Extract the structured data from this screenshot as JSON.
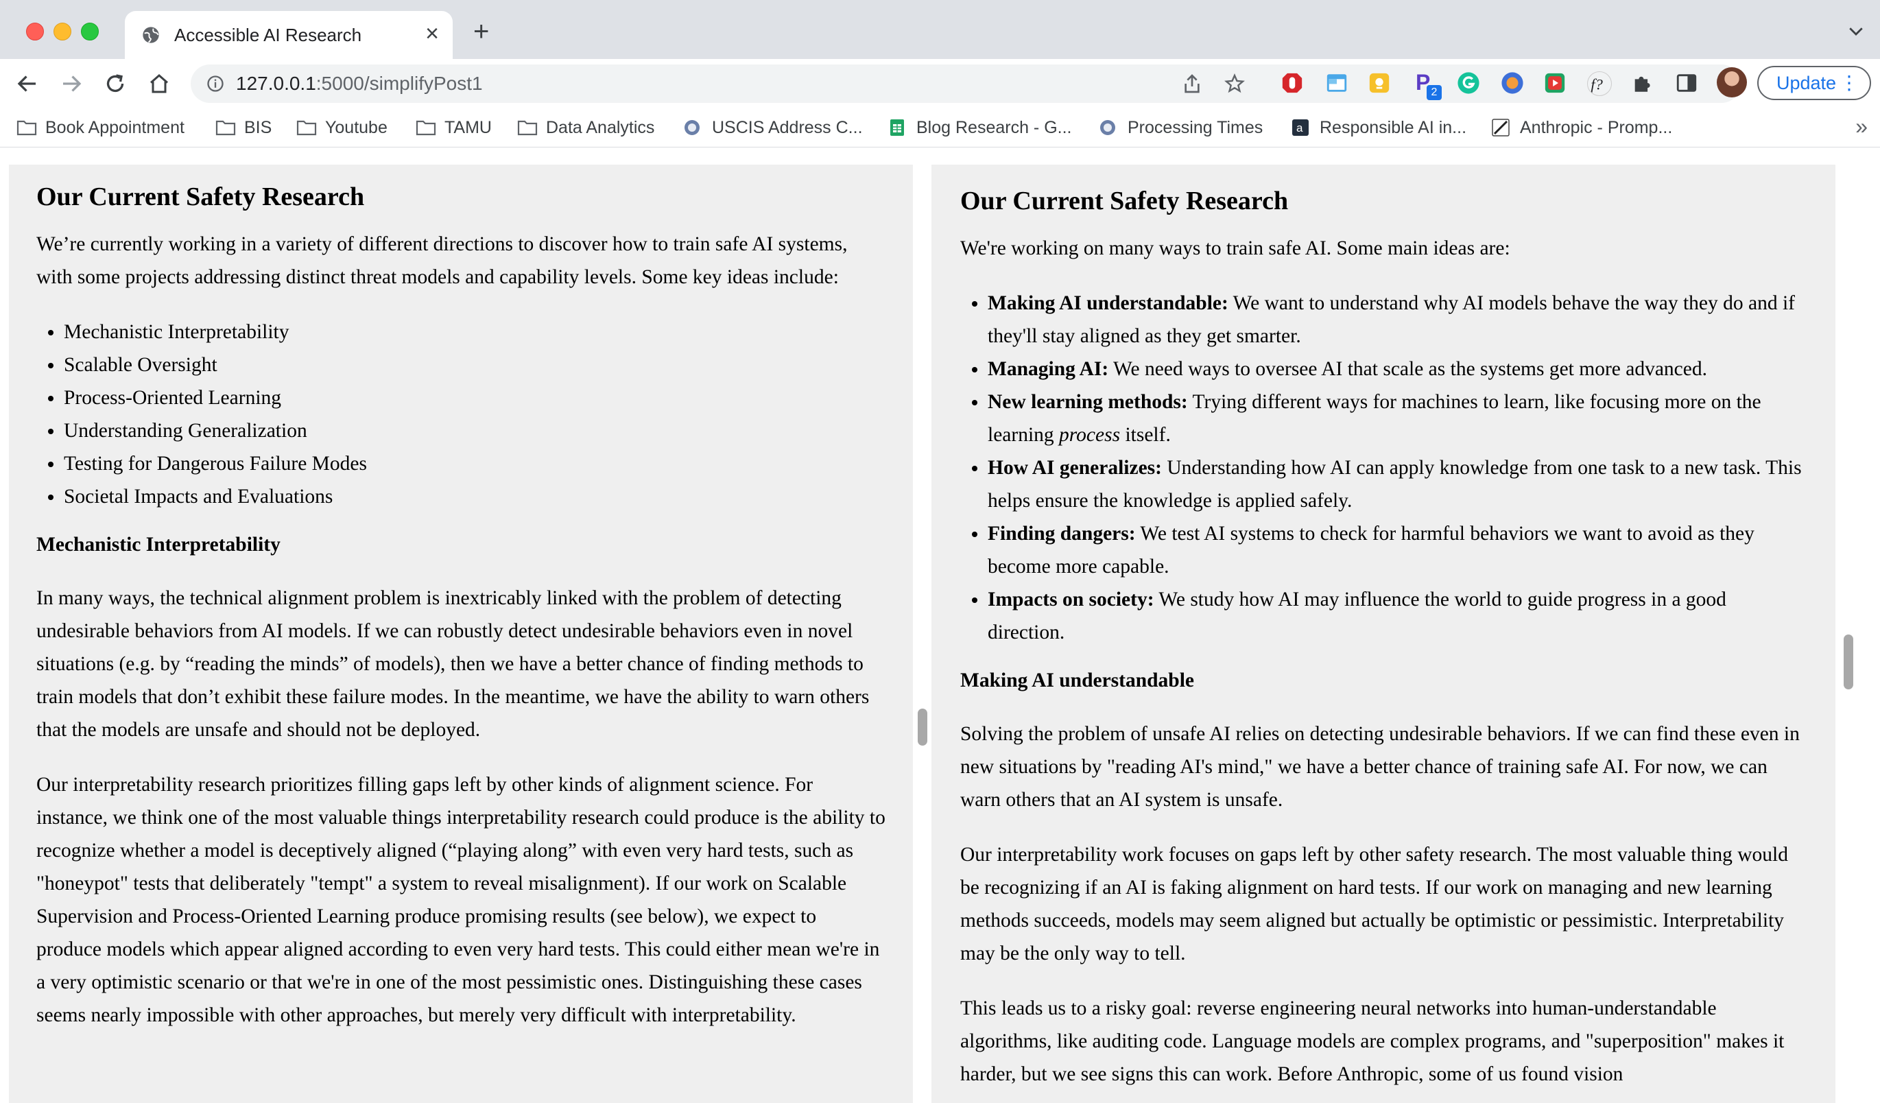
{
  "browser": {
    "tab": {
      "title": "Accessible AI Research"
    },
    "url": {
      "host": "127.0.0.1",
      "path": ":5000/simplifyPost1"
    },
    "update_label": "Update",
    "bookmarks": [
      "Book Appointment",
      "BIS",
      "Youtube",
      "TAMU",
      "Data Analytics",
      "USCIS Address C...",
      "Blog Research - G...",
      "Processing Times",
      "Responsible AI in...",
      "Anthropic - Promp..."
    ],
    "extension_badge": "2"
  },
  "left": {
    "title": "Our Current Safety Research",
    "intro": "We’re currently working in a variety of different directions to discover how to train safe AI systems, with some projects addressing distinct threat models and capability levels. Some key ideas include:",
    "list": [
      "Mechanistic Interpretability",
      "Scalable Oversight",
      "Process-Oriented Learning",
      "Understanding Generalization",
      "Testing for Dangerous Failure Modes",
      "Societal Impacts and Evaluations"
    ],
    "section_heading": "Mechanistic Interpretability",
    "para1": "In many ways, the technical alignment problem is inextricably linked with the problem of detecting undesirable behaviors from AI models. If we can robustly detect undesirable behaviors even in novel situations (e.g. by “reading the minds” of models), then we have a better chance of finding methods to train models that don’t exhibit these failure modes. In the meantime, we have the ability to warn others that the models are unsafe and should not be deployed.",
    "para2": "Our interpretability research prioritizes filling gaps left by other kinds of alignment science. For instance, we think one of the most valuable things interpretability research could produce is the ability to recognize whether a model is deceptively aligned (“playing along” with even very hard tests, such as \"honeypot\" tests that deliberately \"tempt\" a system to reveal misalignment). If our work on Scalable Supervision and Process-Oriented Learning produce promising results (see below), we expect to produce models which appear aligned according to even very hard tests. This could either mean we're in a very optimistic scenario or that we're in one of the most pessimistic ones. Distinguishing these cases seems nearly impossible with other approaches, but merely very difficult with interpretability."
  },
  "right": {
    "title": "Our Current Safety Research",
    "intro": "We're working on many ways to train safe AI. Some main ideas are:",
    "list": [
      {
        "term": "Making AI understandable:",
        "text": " We want to understand why AI models behave the way they do and if they'll stay aligned as they get smarter."
      },
      {
        "term": "Managing AI:",
        "text": " We need ways to oversee AI that scale as the systems get more advanced."
      },
      {
        "term": "New learning methods:",
        "text": " Trying different ways for machines to learn, like focusing more on the learning ",
        "em": "process",
        "after": " itself."
      },
      {
        "term": "How AI generalizes:",
        "text": " Understanding how AI can apply knowledge from one task to a new task. This helps ensure the knowledge is applied safely."
      },
      {
        "term": "Finding dangers:",
        "text": " We test AI systems to check for harmful behaviors we want to avoid as they become more capable."
      },
      {
        "term": "Impacts on society:",
        "text": " We study how AI may influence the world to guide progress in a good direction."
      }
    ],
    "section_heading": "Making AI understandable",
    "para1": "Solving the problem of unsafe AI relies on detecting undesirable behaviors. If we can find these even in new situations by \"reading AI's mind,\" we have a better chance of training safe AI. For now, we can warn others that an AI system is unsafe.",
    "para2": "Our interpretability work focuses on gaps left by other safety research. The most valuable thing would be recognizing if an AI is faking alignment on hard tests. If our work on managing and new learning methods succeeds, models may seem aligned but actually be optimistic or pessimistic. Interpretability may be the only way to tell.",
    "para3": "This leads us to a risky goal: reverse engineering neural networks into human-understandable algorithms, like auditing code. Language models are complex programs, and \"superposition\" makes it harder, but we see signs this can work. Before Anthropic, some of us found vision"
  }
}
